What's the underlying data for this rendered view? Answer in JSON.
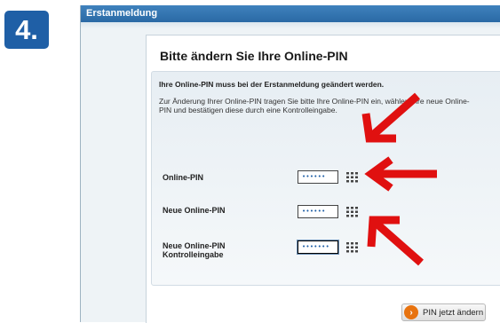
{
  "step": {
    "number": "4."
  },
  "window": {
    "title": "Erstanmeldung"
  },
  "panel": {
    "title": "Bitte ändern Sie Ihre Online-PIN",
    "note_bold": "Ihre Online-PIN muss bei der Erstanmeldung geändert werden.",
    "note_text": "Zur Änderung Ihrer Online-PIN tragen Sie bitte Ihre Online-PIN ein, wählen Ihre neue Online-PIN und bestätigen diese durch eine Kontrolleingabe."
  },
  "fields": [
    {
      "label": "Online-PIN",
      "value": "••••••"
    },
    {
      "label": "Neue Online-PIN",
      "value": "••••••"
    },
    {
      "label_line1": "Neue Online-PIN",
      "label_line2": "Kontrolleingabe",
      "value": "•••••••"
    }
  ],
  "submit": {
    "label": "PIN jetzt ändern"
  },
  "colors": {
    "badge": "#1f5fa6",
    "titlebar": "#2a69a5",
    "arrows": "#e01010",
    "submit_icon": "#e8730f"
  },
  "icons": {
    "keypad": "keypad-grid-icon",
    "submit": "arrow-right-circle-icon",
    "annotation": "red-arrow"
  }
}
